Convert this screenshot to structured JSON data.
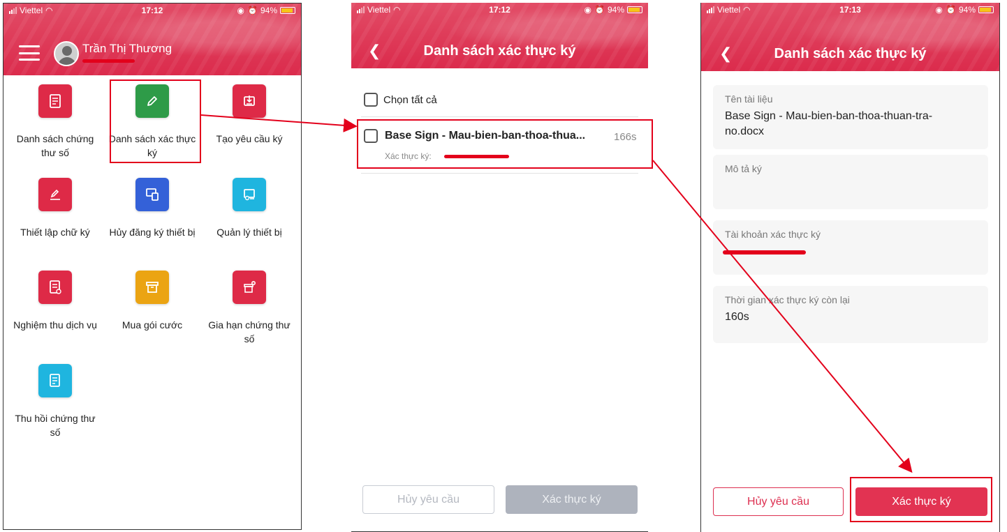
{
  "colors": {
    "brand": "#dd2f50",
    "highlight": "#e3001b",
    "disabled_button": "#aeb3bd"
  },
  "status": {
    "carrier": "Viettel",
    "battery": "94%",
    "time_1": "17:12",
    "time_2": "17:12",
    "time_3": "17:13"
  },
  "screen1": {
    "user_name": "Trần Thị Thương",
    "menu": [
      {
        "label": "Danh sách chứng thư số",
        "icon": "certificate-list-icon",
        "color": "#de2a47"
      },
      {
        "label": "Danh sách xác thực ký",
        "icon": "pencil-icon",
        "color": "#2e9b48"
      },
      {
        "label": "Tạo yêu cầu ký",
        "icon": "sign-request-icon",
        "color": "#de2a47"
      },
      {
        "label": "Thiết lập chữ ký",
        "icon": "signature-icon",
        "color": "#de2a47"
      },
      {
        "label": "Hủy đăng ký thiết bị",
        "icon": "devices-icon",
        "color": "#3461d8"
      },
      {
        "label": "Quản lý thiết bị",
        "icon": "device-settings-icon",
        "color": "#1fb5df"
      },
      {
        "label": "Nghiệm thu dịch vụ",
        "icon": "acceptance-doc-icon",
        "color": "#de2a47"
      },
      {
        "label": "Mua gói cước",
        "icon": "package-icon",
        "color": "#eba413"
      },
      {
        "label": "Gia hạn chứng thư số",
        "icon": "renew-box-icon",
        "color": "#de2a47"
      },
      {
        "label": "Thu hồi chứng thư số",
        "icon": "revoke-doc-icon",
        "color": "#1fb5df"
      }
    ]
  },
  "screen2": {
    "title": "Danh sách xác thực ký",
    "select_all": "Chọn tất cả",
    "item": {
      "name": "Base Sign - Mau-bien-ban-thoa-thua...",
      "countdown": "166s",
      "account_label": "Xác thực ký:"
    },
    "cancel_button": "Hủy yêu cầu",
    "confirm_button": "Xác thực ký"
  },
  "screen3": {
    "title": "Danh sách xác thực ký",
    "fields": [
      {
        "label": "Tên tài liệu",
        "value": "Base Sign - Mau-bien-ban-thoa-thuan-tra-no.docx"
      },
      {
        "label": "Mô tả ký",
        "value": ""
      },
      {
        "label": "Tài khoản xác thực ký",
        "value": ""
      },
      {
        "label": "Thời gian xác thực ký còn lại",
        "value": "160s"
      }
    ],
    "cancel_button": "Hủy yêu cầu",
    "confirm_button": "Xác thực ký"
  }
}
